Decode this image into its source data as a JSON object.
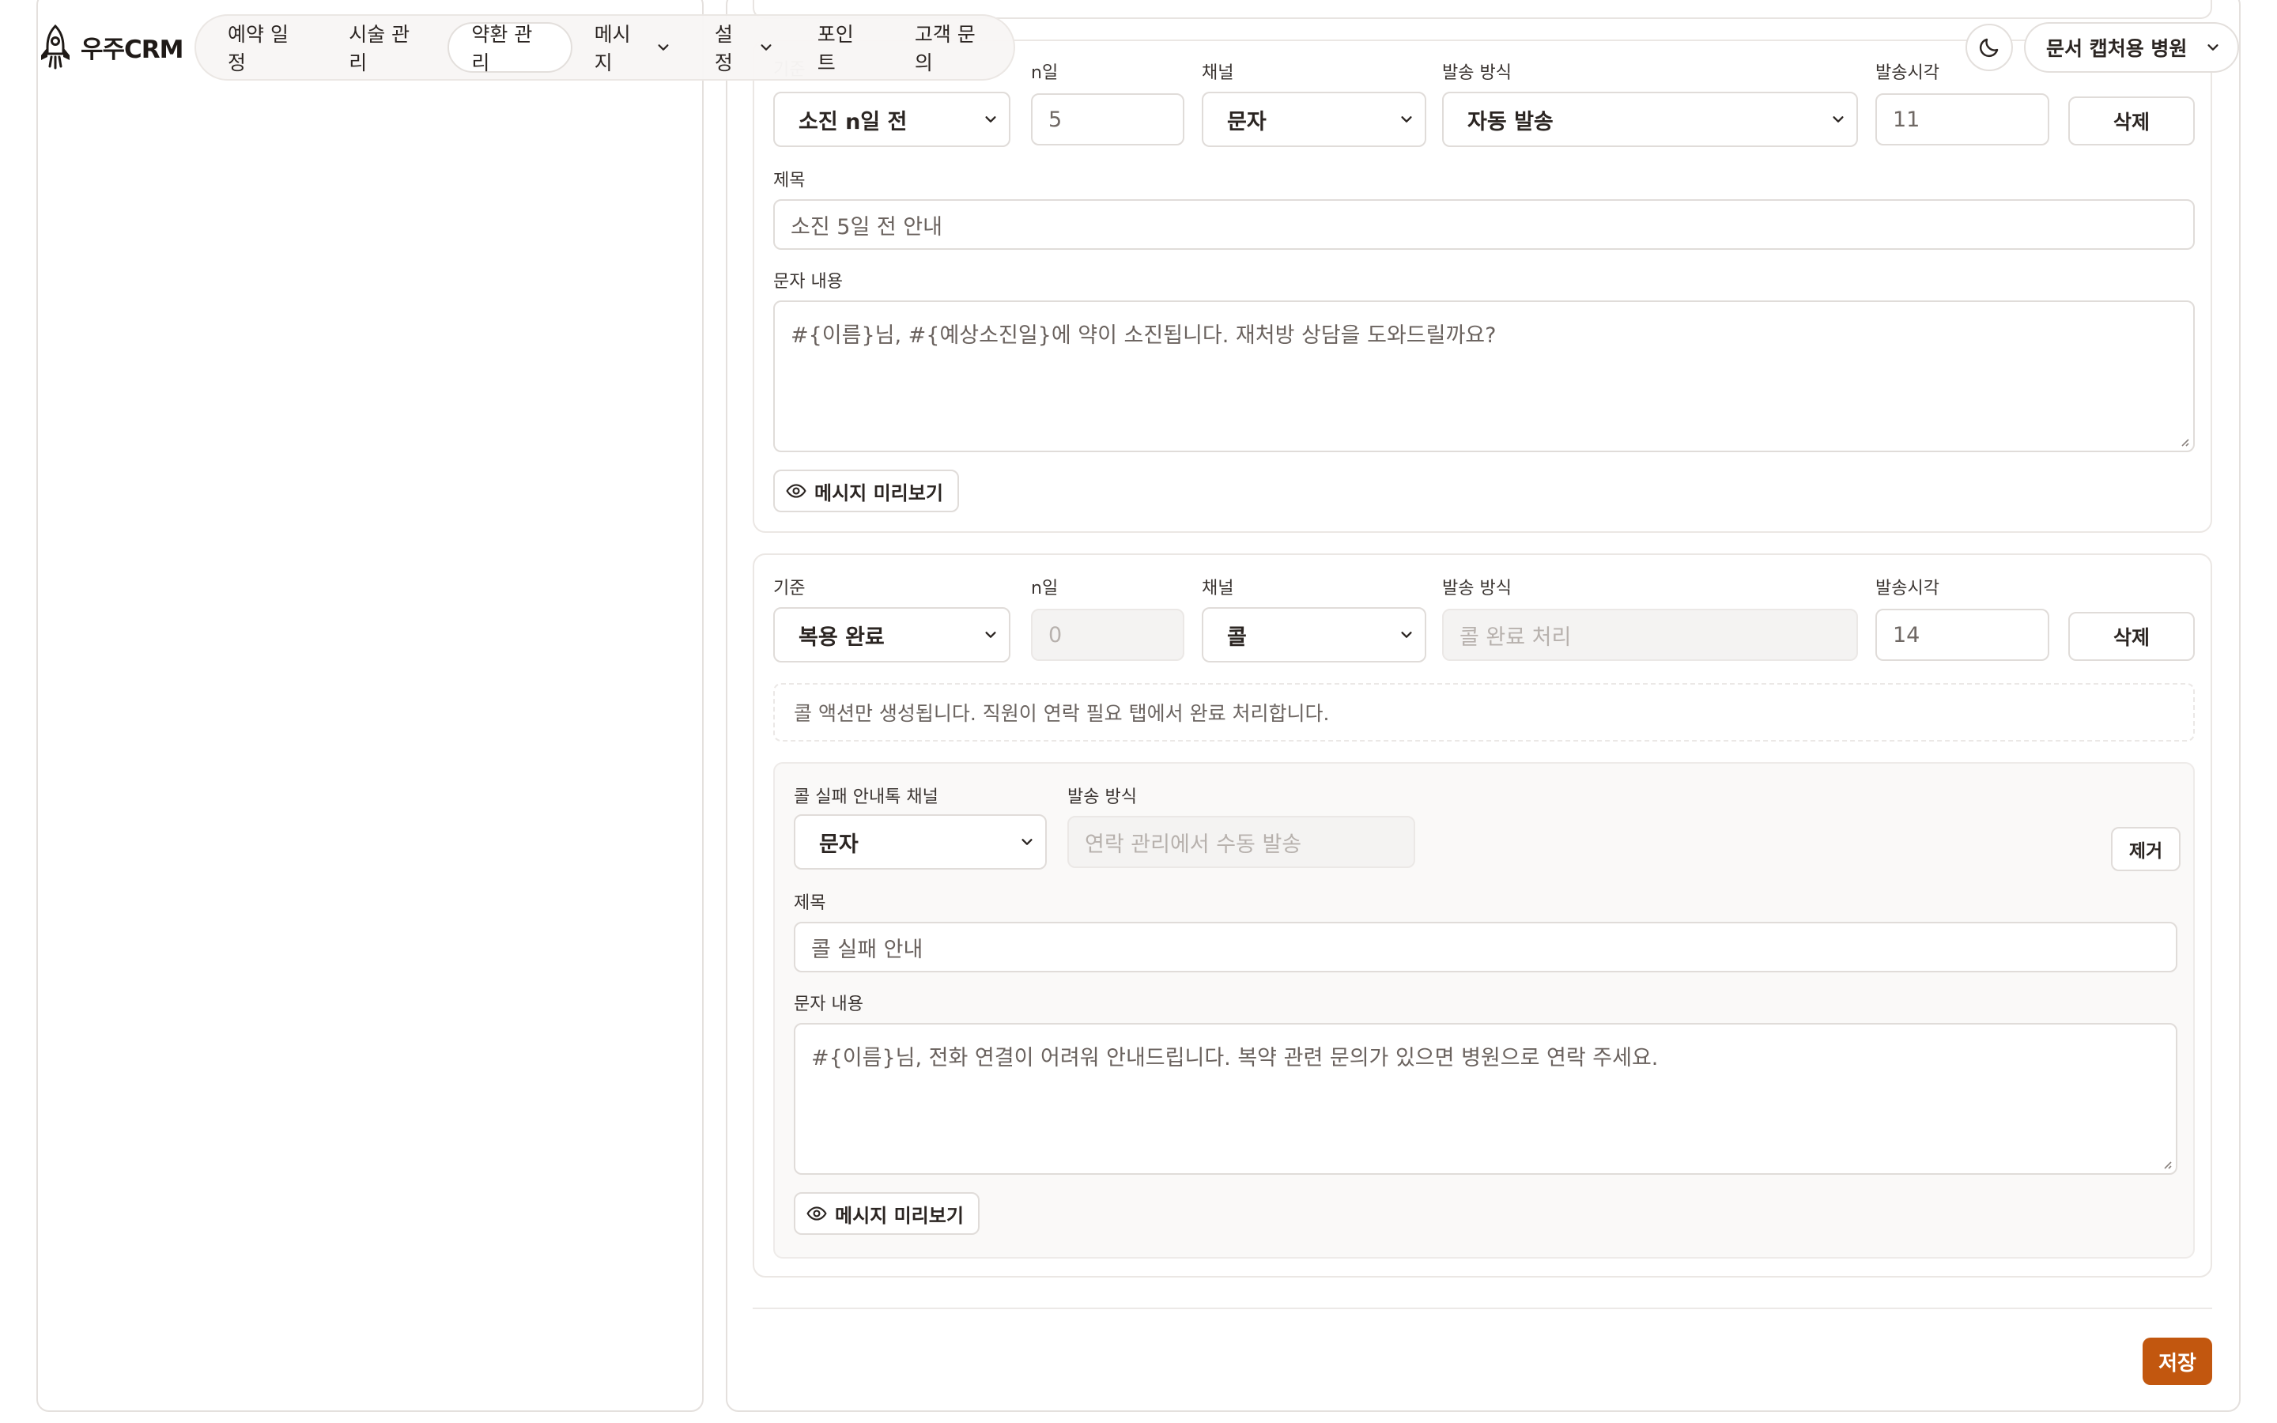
{
  "app": {
    "logo_text": "우주CRM"
  },
  "nav": {
    "items": [
      {
        "label": "예약 일정"
      },
      {
        "label": "시술 관리"
      },
      {
        "label": "약환 관리",
        "active": true
      },
      {
        "label": "메시지",
        "dropdown": true
      },
      {
        "label": "설정",
        "dropdown": true
      },
      {
        "label": "포인트"
      },
      {
        "label": "고객 문의"
      }
    ]
  },
  "header": {
    "theme_icon": "moon-icon",
    "hospital_label": "문서 캡처용 병원"
  },
  "rule1": {
    "label_basis": "기준",
    "basis_value": "소진 n일 전",
    "label_nday": "n일",
    "nday_value": "5",
    "label_channel": "채널",
    "channel_value": "문자",
    "label_method": "발송 방식",
    "method_value": "자동 발송",
    "label_time": "발송시각",
    "time_value": "11",
    "delete_label": "삭제",
    "label_subject": "제목",
    "subject_value": "소진 5일 전 안내",
    "label_body": "문자 내용",
    "body_value": "#{이름}님, #{예상소진일}에 약이 소진됩니다. 재처방 상담을 도와드릴까요?",
    "preview_label": "메시지 미리보기"
  },
  "rule2": {
    "label_basis": "기준",
    "basis_value": "복용 완료",
    "label_nday": "n일",
    "nday_placeholder": "0",
    "label_channel": "채널",
    "channel_value": "콜",
    "label_method": "발송 방식",
    "method_placeholder": "콜 완료 처리",
    "label_time": "발송시각",
    "time_value": "14",
    "delete_label": "삭제",
    "note": "콜 액션만 생성됩니다. 직원이 연락 필요 탭에서 완료 처리합니다.",
    "fallback": {
      "label_channel": "콜 실패 안내톡 채널",
      "channel_value": "문자",
      "label_method": "발송 방식",
      "method_placeholder": "연락 관리에서 수동 발송",
      "remove_label": "제거",
      "label_subject": "제목",
      "subject_value": "콜 실패 안내",
      "label_body": "문자 내용",
      "body_value": "#{이름}님, 전화 연결이 어려워 안내드립니다. 복약 관련 문의가 있으면 병원으로 연락 주세요.",
      "preview_label": "메시지 미리보기"
    }
  },
  "footer": {
    "save_label": "저장"
  },
  "colors": {
    "accent": "#c2570f",
    "border": "#e0dcd9"
  }
}
